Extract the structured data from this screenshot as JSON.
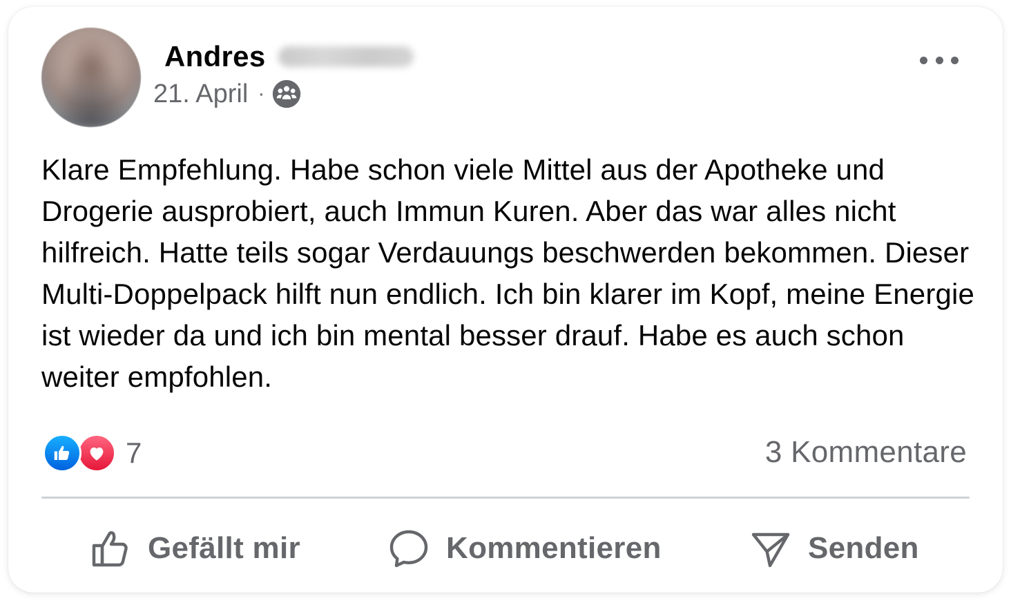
{
  "post": {
    "author_first_name": "Andres",
    "date": "21. April",
    "separator": "·",
    "audience_icon": "friends-icon",
    "more_icon": "more-options-icon",
    "text": "Klare Empfehlung. Habe schon viele Mittel aus der Apotheke und Drogerie ausprobiert, auch Immun Kuren. Aber das war alles nicht hilfreich. Hatte teils sogar Verdauungs beschwerden bekommen. Dieser Multi-Doppelpack hilft nun endlich. Ich bin klarer im Kopf, meine Energie ist wieder da und ich bin mental besser drauf. Habe es auch schon weiter empfohlen."
  },
  "engagement": {
    "reaction_icons": [
      "like-icon",
      "love-icon"
    ],
    "reaction_count": "7",
    "comments_label": "3 Kommentare"
  },
  "actions": {
    "like_label": "Gefällt mir",
    "comment_label": "Kommentieren",
    "send_label": "Senden"
  },
  "colors": {
    "text_primary": "#050505",
    "text_secondary": "#65676b",
    "like_blue": "#0866ff",
    "love_red": "#f33e58",
    "divider": "#ced0d4"
  }
}
